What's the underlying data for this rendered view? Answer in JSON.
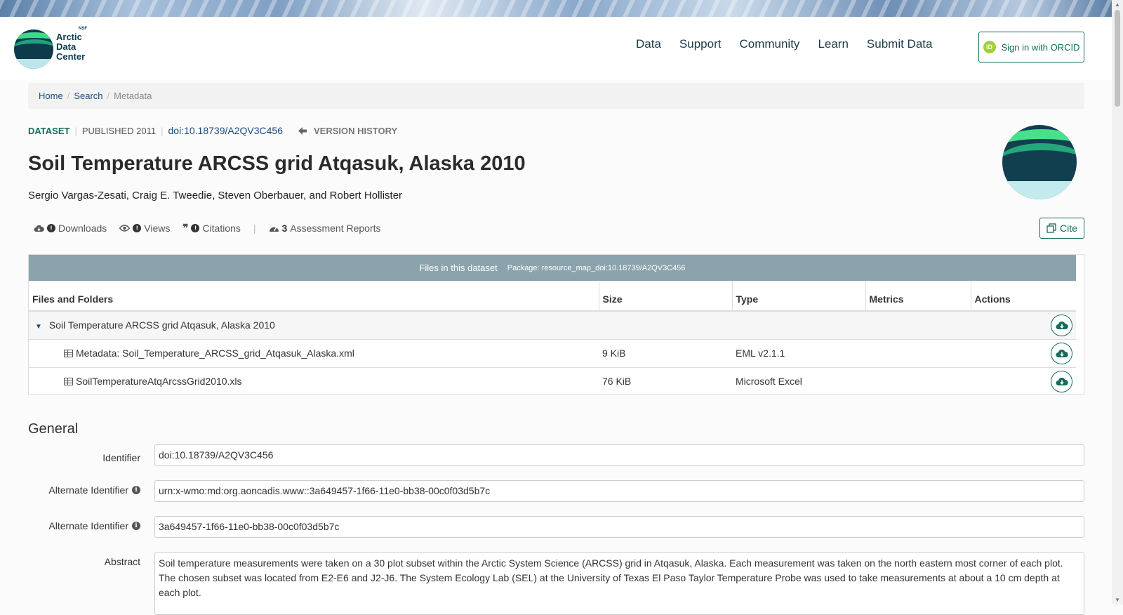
{
  "nav": {
    "logo_text": "Arctic Data Center",
    "logo_nsf": "NSF",
    "links": [
      "Data",
      "Support",
      "Community",
      "Learn",
      "Submit Data"
    ],
    "orcid_label": "Sign in with ORCID",
    "orcid_icon_text": "iD"
  },
  "breadcrumb": {
    "home": "Home",
    "search": "Search",
    "current": "Metadata"
  },
  "header": {
    "type_label": "DATASET",
    "published": "PUBLISHED 2011",
    "doi": "doi:10.18739/A2QV3C456",
    "version_history": "VERSION HISTORY",
    "title": "Soil Temperature ARCSS grid Atqasuk, Alaska 2010",
    "authors": "Sergio Vargas-Zesati, Craig E. Tweedie, Steven Oberbauer, and Robert Hollister"
  },
  "metrics": {
    "downloads": "Downloads",
    "views": "Views",
    "citations": "Citations",
    "assessment_count": "3",
    "assessment_label": "Assessment Reports",
    "cite_label": "Cite"
  },
  "files": {
    "header_title": "Files in this dataset",
    "package": "Package: resource_map_doi:10.18739/A2QV3C456",
    "columns": [
      "Files and Folders",
      "Size",
      "Type",
      "Metrics",
      "Actions"
    ],
    "folder": "Soil Temperature ARCSS grid Atqasuk, Alaska 2010",
    "rows": [
      {
        "name": "Metadata: Soil_Temperature_ARCSS_grid_Atqasuk_Alaska.xml",
        "size": "9 KiB",
        "type": "EML v2.1.1"
      },
      {
        "name": "SoilTemperatureAtqArcssGrid2010.xls",
        "size": "76 KiB",
        "type": "Microsoft Excel"
      }
    ]
  },
  "general": {
    "section_title": "General",
    "identifier_label": "Identifier",
    "identifier": "doi:10.18739/A2QV3C456",
    "alt1_label": "Alternate Identifier",
    "alt1": "urn:x-wmo:md:org.aoncadis.www::3a649457-1f66-11e0-bb38-00c0f03d5b7c",
    "alt2_label": "Alternate Identifier",
    "alt2": "3a649457-1f66-11e0-bb38-00c0f03d5b7c",
    "abstract_label": "Abstract",
    "abstract": "Soil temperature measurements were taken on a 30 plot subset within the Arctic System Science (ARCSS) grid in Atqasuk, Alaska. Each measurement was taken on the north eastern most corner of each plot. The chosen subset was located from E2-E6 and J2-J6. The System Ecology Lab (SEL) at the University of Texas El Paso Taylor Temperature Probe was used to take measurements at about a 10 cm depth at each plot."
  },
  "colors": {
    "accent": "#0f6e5a",
    "link": "#1a4a7a",
    "files_header": "#8ba3ad"
  }
}
